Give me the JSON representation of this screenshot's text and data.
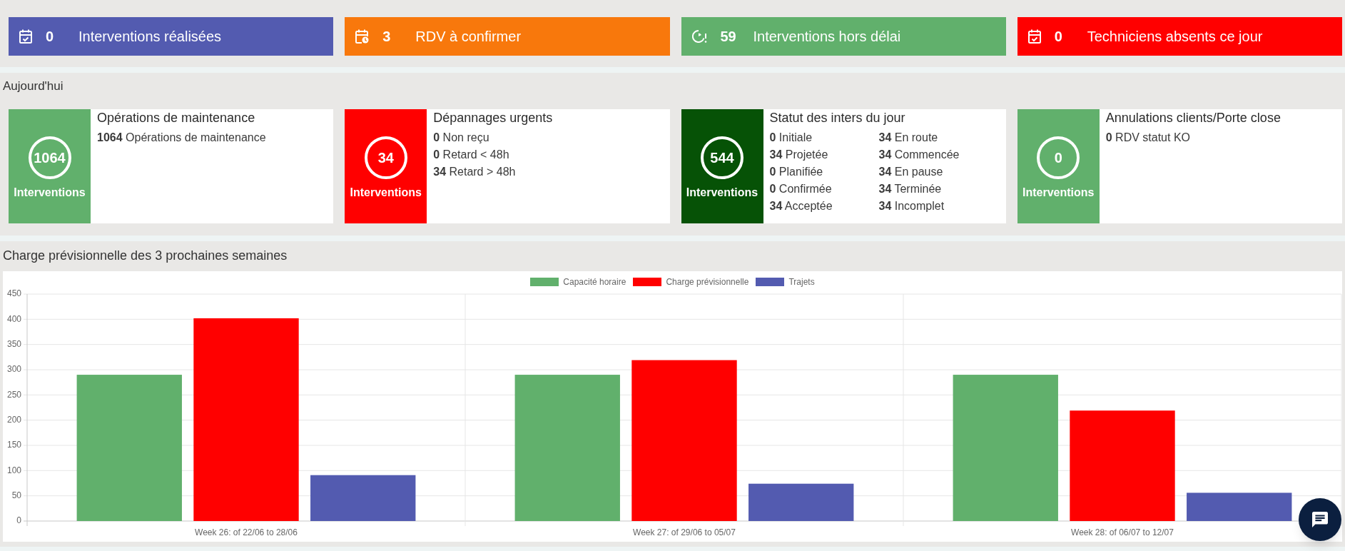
{
  "summary_tiles": [
    {
      "kind": "completed",
      "color": "#535bb0",
      "count": "0",
      "label": "Interventions réalisées"
    },
    {
      "kind": "pending",
      "color": "#f8780c",
      "count": "3",
      "label": "RDV à confirmer"
    },
    {
      "kind": "late",
      "color": "#61b06c",
      "count": "59",
      "label": "Interventions hors délai"
    },
    {
      "kind": "absent",
      "color": "#ff0000",
      "count": "0",
      "label": "Techniciens absents ce jour"
    }
  ],
  "today": {
    "title": "Aujourd'hui",
    "cards": [
      {
        "title": "Opérations de maintenance",
        "color": "#61b06c",
        "total": "1064",
        "total_label": "Interventions",
        "columns": [
          [
            "**1064** Opérations de maintenance"
          ]
        ]
      },
      {
        "title": "Dépannages urgents",
        "color": "#ff0000",
        "total": "34",
        "total_label": "Interventions",
        "columns": [
          [
            "**0** Non reçu",
            "**0** Retard < 48h",
            "**34** Retard > 48h"
          ]
        ]
      },
      {
        "title": "Statut des inters du jour",
        "color": "#065206",
        "total": "544",
        "total_label": "Interventions",
        "columns": [
          [
            "**0** Initiale",
            "**34** Projetée",
            "**0** Planifiée",
            "**0** Confirmée",
            "**34** Acceptée"
          ],
          [
            "**34** En route",
            "**34** Commencée",
            "**34** En pause",
            "**34** Terminée",
            "**34** Incomplet"
          ]
        ]
      },
      {
        "title": "Annulations clients/Porte close",
        "color": "#61b06c",
        "total": "0",
        "total_label": "Interventions",
        "columns": [
          [
            "**0** RDV statut KO"
          ]
        ]
      }
    ]
  },
  "forecast": {
    "title": "Charge prévisionnelle des 3 prochaines semaines",
    "chart_data": {
      "type": "bar",
      "legend": true,
      "grid": true,
      "categories": [
        "Week 26: of 22/06 to 28/06",
        "Week 27: of 29/06 to 05/07",
        "Week 28: of 06/07 to 12/07"
      ],
      "series": [
        {
          "name": "Capacité horaire",
          "color": "#61b06c",
          "values": [
            290,
            290,
            290
          ]
        },
        {
          "name": "Charge prévisionnelle",
          "color": "#ff0000",
          "values": [
            402,
            319,
            219
          ]
        },
        {
          "name": "Trajets",
          "color": "#535bb0",
          "values": [
            91,
            74,
            56
          ]
        }
      ],
      "ylim": [
        0,
        450
      ],
      "yticks": [
        {
          "value": 0,
          "label": "0"
        },
        50,
        100,
        150,
        200,
        250,
        300,
        350,
        400,
        450
      ]
    }
  }
}
